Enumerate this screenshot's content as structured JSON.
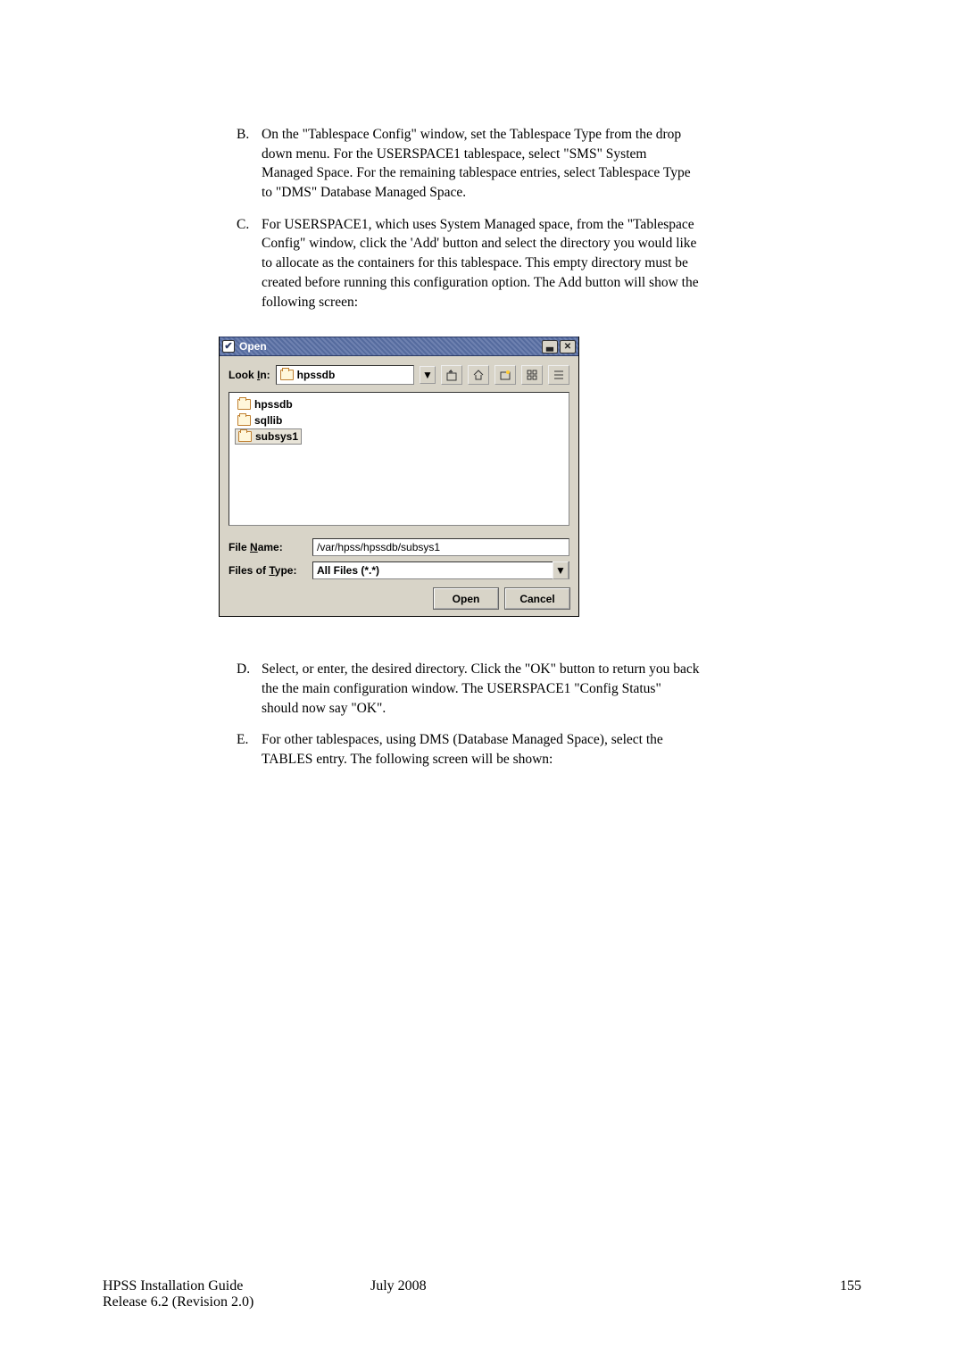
{
  "list": {
    "B": {
      "marker": "B.",
      "text": "On the \"Tablespace Config\" window, set the Tablespace Type from the drop down menu.  For the USERSPACE1 tablespace, select \"SMS\" System Managed Space.  For the remaining tablespace entries, select Tablespace Type to \"DMS\" Database Managed Space."
    },
    "C": {
      "marker": "C.",
      "text": "For USERSPACE1, which uses System Managed space, from the \"Tablespace Config\" window, click the 'Add' button and select the directory you would like to allocate as the containers for this tablespace.  This empty directory must be created before running this configuration option.  The Add button will show the following screen:"
    }
  },
  "dialog": {
    "title": "Open",
    "lookInLabel": "Look ",
    "lookInLabelUL": "I",
    "lookInLabelAfter": "n:",
    "lookInValue": "hpssdb",
    "files": [
      "hpssdb",
      "sqllib",
      "subsys1"
    ],
    "fileNameLabel": "File ",
    "fileNameLabelUL": "N",
    "fileNameLabelAfter": "ame:",
    "fileNameValue": "/var/hpss/hpssdb/subsys1",
    "filesTypeLabel": "Files of ",
    "filesTypeLabelUL": "T",
    "filesTypeLabelAfter": "ype:",
    "filesTypeValue": "All Files (*.*)",
    "openBtn": "Open",
    "openBtnUL": "O",
    "openBtnAfter": "pen",
    "cancelBtnUL": "C",
    "cancelBtnAfter": "ancel"
  },
  "list2": {
    "D": {
      "marker": "D.",
      "text": "Select, or enter, the desired directory.  Click the \"OK\" button to return you back the the main configuration window.  The USERSPACE1 \"Config Status\" should now say \"OK\"."
    },
    "E": {
      "marker": "E.",
      "text": "For other tablespaces, using DMS (Database Managed Space), select the TABLES entry.  The following screen will be shown:"
    }
  },
  "footer": {
    "left1": "HPSS Installation Guide",
    "left2": "Release 6.2 (Revision 2.0)",
    "center": "July 2008",
    "right": "155"
  }
}
